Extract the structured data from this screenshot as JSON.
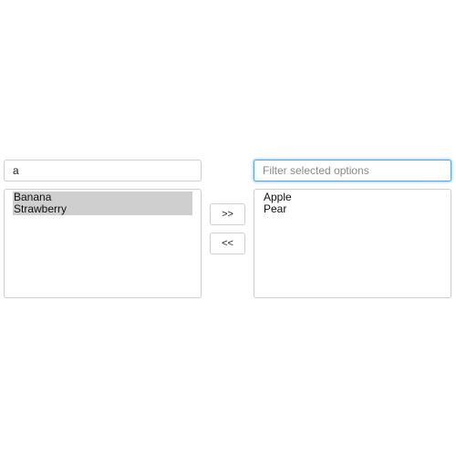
{
  "available": {
    "filter_value": "a",
    "filter_placeholder": "",
    "options": [
      {
        "label": "Banana",
        "highlighted": true
      },
      {
        "label": "Strawberry",
        "highlighted": true
      }
    ]
  },
  "selected": {
    "filter_value": "",
    "filter_placeholder": "Filter selected options",
    "focused": true,
    "options": [
      {
        "label": "Apple",
        "highlighted": false
      },
      {
        "label": "Pear",
        "highlighted": false
      }
    ]
  },
  "buttons": {
    "move_right_label": ">>",
    "move_left_label": "<<"
  },
  "colors": {
    "highlight": "#cfcfcf",
    "focus_ring": "#5aa7e6",
    "border": "#cfcfcf"
  }
}
